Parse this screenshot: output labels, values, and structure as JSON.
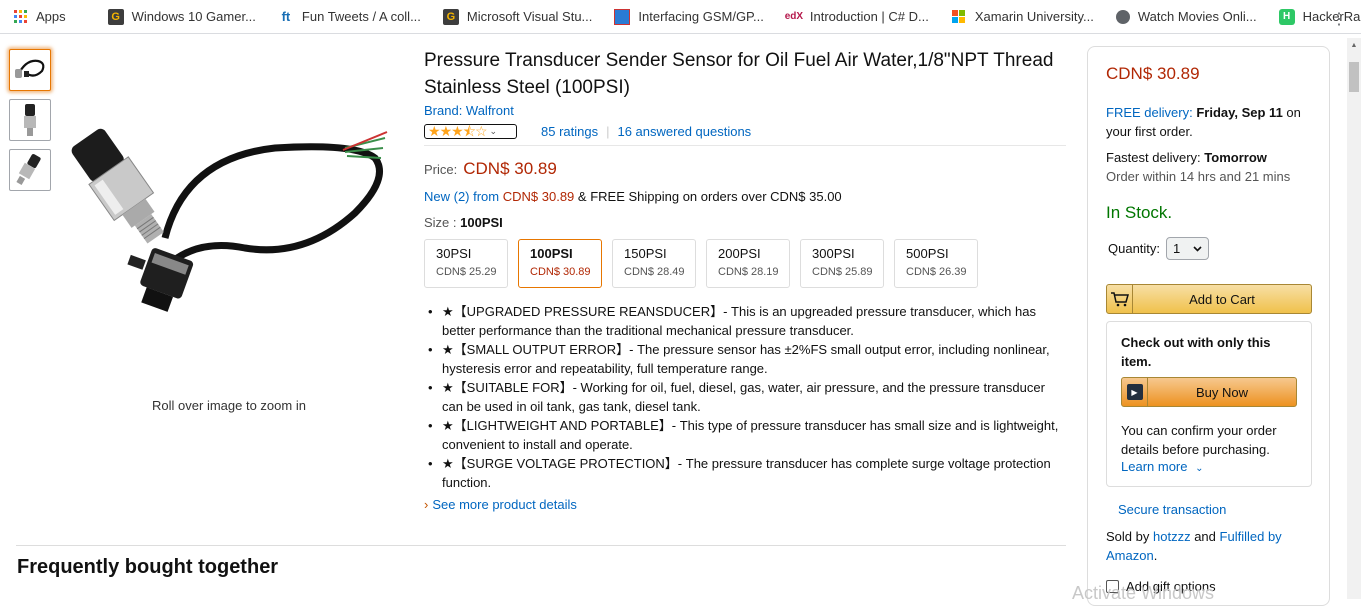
{
  "bookmarks": [
    {
      "label": "Apps",
      "icon": "apps-grid-icon"
    },
    {
      "label": "Windows 10 Gamer...",
      "icon": "g-logo-icon"
    },
    {
      "label": "Fun Tweets / A coll...",
      "icon": "ft-logo-icon"
    },
    {
      "label": "Microsoft Visual Stu...",
      "icon": "g-logo-icon"
    },
    {
      "label": "Interfacing GSM/GP...",
      "icon": "image-icon"
    },
    {
      "label": "Introduction | C# D...",
      "icon": "edx-logo-icon"
    },
    {
      "label": "Xamarin University...",
      "icon": "microsoft-logo-icon"
    },
    {
      "label": "Watch Movies Onli...",
      "icon": "globe-icon"
    },
    {
      "label": "HackerRank",
      "icon": "hackerrank-logo-icon"
    }
  ],
  "product": {
    "title": "Pressure Transducer Sender Sensor for Oil Fuel Air Water,1/8\"NPT Thread Stainless Steel (100PSI)",
    "brand": "Brand: Walfront",
    "rating_value": 3.5,
    "ratings_text": "85 ratings",
    "questions_text": "16 answered questions",
    "price_label": "Price:",
    "price": "CDN$ 30.89",
    "new_from_prefix": "New (2) from",
    "new_from_price": "CDN$ 30.89",
    "new_from_suffix": "& FREE Shipping on orders over CDN$ 35.00",
    "size_label": "Size :",
    "size_selected": "100PSI",
    "zoom_hint": "Roll over image to zoom in",
    "see_more": "See more product details"
  },
  "sizes": [
    {
      "name": "30PSI",
      "price": "CDN$ 25.29"
    },
    {
      "name": "100PSI",
      "price": "CDN$ 30.89"
    },
    {
      "name": "150PSI",
      "price": "CDN$ 28.49"
    },
    {
      "name": "200PSI",
      "price": "CDN$ 28.19"
    },
    {
      "name": "300PSI",
      "price": "CDN$ 25.89"
    },
    {
      "name": "500PSI",
      "price": "CDN$ 26.39"
    }
  ],
  "bullets": [
    "★【UPGRADED PRESSURE REANSDUCER】- This is an upgreaded pressure transducer, which has better performance than the traditional mechanical pressure transducer.",
    "★【SMALL OUTPUT ERROR】- The pressure sensor has ±2%FS small output error, including nonlinear, hysteresis error and repeatability, full temperature range.",
    "★【SUITABLE FOR】- Working for oil, fuel, diesel, gas, water, air pressure, and the pressure transducer can be used in oil tank, gas tank, diesel tank.",
    "★【LIGHTWEIGHT AND PORTABLE】- This type of pressure transducer has small size and is lightweight, convenient to install and operate.",
    "★【SURGE VOLTAGE PROTECTION】- The pressure transducer has complete surge voltage protection function."
  ],
  "section_heading": "Frequently bought together",
  "buybox": {
    "price": "CDN$ 30.89",
    "free_delivery": "FREE delivery:",
    "delivery_date": "Friday, Sep 11",
    "delivery_suffix_1": "on",
    "delivery_suffix_2": "your first order.",
    "fastest_label": "Fastest delivery:",
    "fastest_value": "Tomorrow",
    "order_within": "Order within 14 hrs and 21 mins",
    "stock": "In Stock.",
    "quantity_label": "Quantity:",
    "quantity_value": "1",
    "add_to_cart": "Add to Cart",
    "checkout_heading": "Check out with only this item.",
    "buy_now": "Buy Now",
    "confirm_text": "You can confirm your order details before purchasing.",
    "learn_more": "Learn more",
    "secure": "Secure transaction",
    "sold_by_prefix": "Sold by",
    "seller": "hotzzz",
    "and": "and",
    "fulfilled": "Fulfilled by Amazon",
    "period": ".",
    "gift": "Add gift options"
  },
  "watermark": "Activate Windows",
  "colors": {
    "price": "#b12704",
    "link": "#0066c0",
    "stock": "#007600",
    "accent": "#e77600"
  }
}
